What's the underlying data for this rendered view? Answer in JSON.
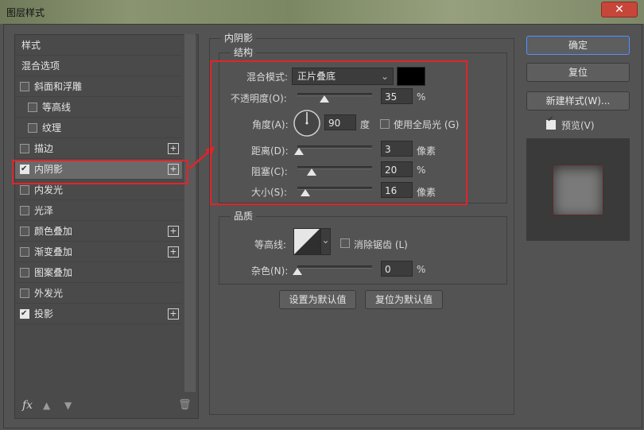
{
  "window": {
    "title": "图层样式",
    "close_label": "✕"
  },
  "left_list": {
    "items": [
      {
        "label": "样式",
        "checkbox": false,
        "checked": false,
        "plus": false
      },
      {
        "label": "混合选项",
        "checkbox": false,
        "checked": false,
        "plus": false
      },
      {
        "label": "斜面和浮雕",
        "checkbox": true,
        "checked": false,
        "plus": false
      },
      {
        "label": "等高线",
        "checkbox": true,
        "checked": false,
        "plus": false
      },
      {
        "label": "纹理",
        "checkbox": true,
        "checked": false,
        "plus": false
      },
      {
        "label": "描边",
        "checkbox": true,
        "checked": false,
        "plus": true
      },
      {
        "label": "内阴影",
        "checkbox": true,
        "checked": true,
        "plus": true
      },
      {
        "label": "内发光",
        "checkbox": true,
        "checked": false,
        "plus": false
      },
      {
        "label": "光泽",
        "checkbox": true,
        "checked": false,
        "plus": false
      },
      {
        "label": "颜色叠加",
        "checkbox": true,
        "checked": false,
        "plus": true
      },
      {
        "label": "渐变叠加",
        "checkbox": true,
        "checked": false,
        "plus": true
      },
      {
        "label": "图案叠加",
        "checkbox": true,
        "checked": false,
        "plus": false
      },
      {
        "label": "外发光",
        "checkbox": true,
        "checked": false,
        "plus": false
      },
      {
        "label": "投影",
        "checkbox": true,
        "checked": true,
        "plus": true
      }
    ],
    "fx_label": "fx",
    "plus_glyph": "+"
  },
  "inner_shadow": {
    "section_title": "内阴影",
    "structure": {
      "title": "结构",
      "blend_mode_label": "混合模式:",
      "blend_mode_value": "正片叠底",
      "swatch_color": "#000000",
      "opacity_label": "不透明度(O):",
      "opacity_value": "35",
      "percent": "%",
      "angle_label": "角度(A):",
      "angle_value": "90",
      "degree": "度",
      "global_light_label": "使用全局光 (G)",
      "distance_label": "距离(D):",
      "distance_value": "3",
      "choke_label": "阻塞(C):",
      "choke_value": "20",
      "size_label": "大小(S):",
      "size_value": "16",
      "pixels": "像素"
    },
    "quality": {
      "title": "品质",
      "contour_label": "等高线:",
      "anti_alias_label": "消除锯齿 (L)",
      "noise_label": "杂色(N):",
      "noise_value": "0",
      "percent": "%"
    },
    "set_default_label": "设置为默认值",
    "reset_default_label": "复位为默认值"
  },
  "right": {
    "ok_label": "确定",
    "reset_label": "复位",
    "new_style_label": "新建样式(W)...",
    "preview_label": "预览(V)"
  },
  "colors": {
    "highlight": "#e2242a",
    "accent": "#6d8fd0"
  }
}
